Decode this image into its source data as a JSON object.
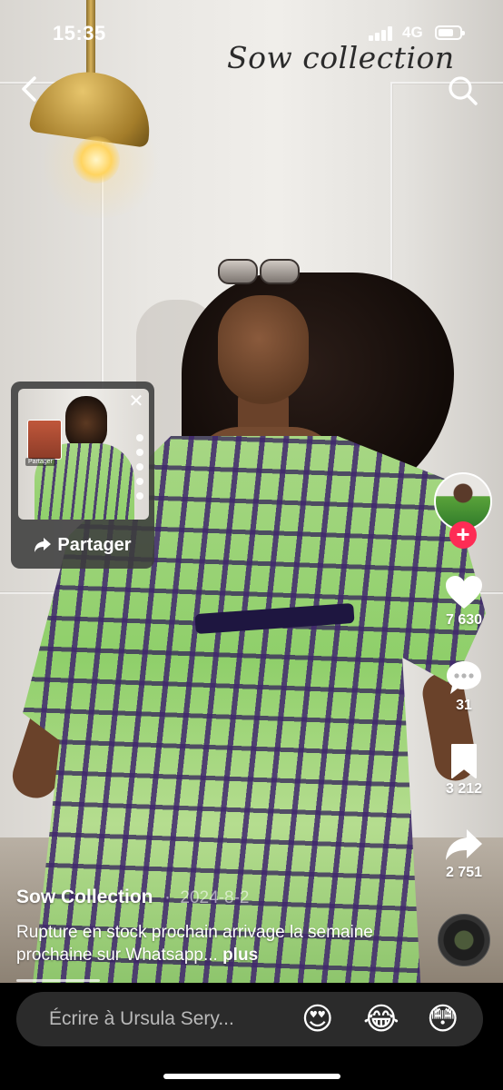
{
  "status_bar": {
    "time": "15:35",
    "network": "4G"
  },
  "header": {
    "brand": "Sow collection"
  },
  "share_popup": {
    "button_label": "Partager",
    "close_symbol": "✕",
    "thumb_share_label": "Partager"
  },
  "actions": {
    "likes": "7 630",
    "comments": "31",
    "saves": "3 212",
    "shares": "2 751"
  },
  "post": {
    "username": "Sow Collection",
    "separator": "·",
    "date": "2024-8-2",
    "description": "Rupture en stock prochain arrivage la semaine prochaine sur Whatsapp...",
    "more": "plus"
  },
  "comment_bar": {
    "placeholder": "Écrire à Ursula Sery...",
    "emojis": [
      "😍",
      "😂",
      "😳"
    ]
  },
  "colors": {
    "follow_accent": "#fe2c55",
    "bar_bg": "#2b2b2b"
  },
  "icons": [
    "back-arrow-icon",
    "search-icon",
    "heart-icon",
    "comment-bubble-icon",
    "bookmark-icon",
    "share-arrow-icon",
    "plus-icon",
    "music-disc-icon"
  ]
}
